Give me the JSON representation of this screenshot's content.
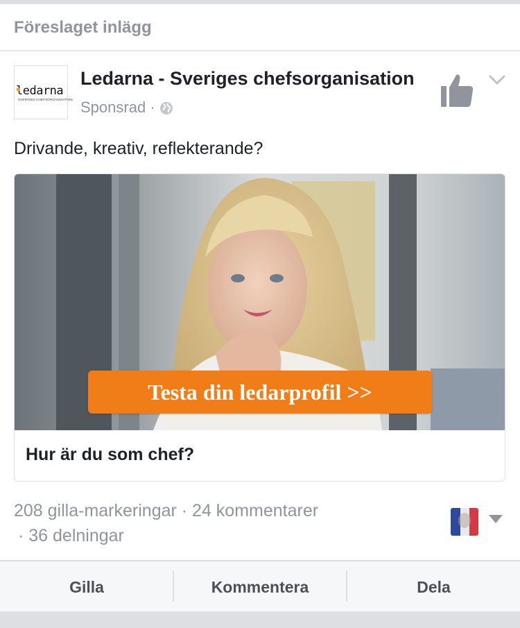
{
  "header": {
    "suggested_label": "Föreslaget inlägg"
  },
  "post": {
    "avatar": {
      "logo_text": "ledarna",
      "logo_subtext": "SVERIGES CHEFSORGANISATION"
    },
    "page_name": "Ledarna - Sveriges chefsorganisation",
    "sponsored_label": "Sponsrad",
    "meta_separator": "·",
    "text": "Drivande, kreativ, reflekterande?",
    "icons": {
      "like_page": "thumbs-up-icon",
      "options": "chevron-down-icon",
      "audience": "globe-icon"
    },
    "card": {
      "cta_label": "Testa din ledarprofil >>",
      "title": "Hur är du som chef?"
    },
    "stats": {
      "line1": "208 gilla-markeringar · 24 kommentarer",
      "line2": "· 36 delningar"
    },
    "actions": {
      "like": "Gilla",
      "comment": "Kommentera",
      "share": "Dela"
    }
  },
  "colors": {
    "cta": "#f07d18",
    "text": "#1d2129",
    "muted": "#90949c",
    "action_bg": "#f6f7f9"
  }
}
